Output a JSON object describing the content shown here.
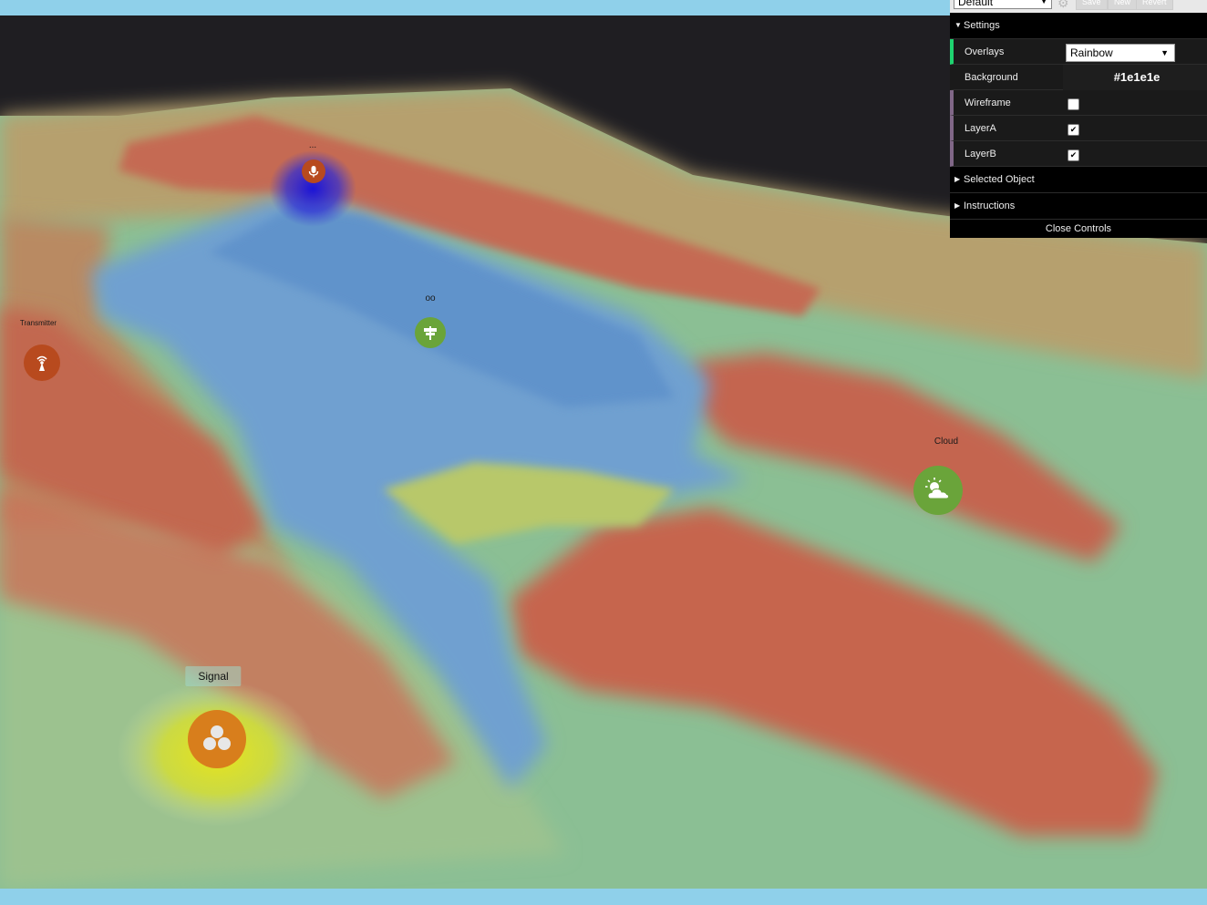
{
  "toolbar": {
    "preset_value": "Default",
    "save_label": "Save",
    "new_label": "New",
    "revert_label": "Revert"
  },
  "gui": {
    "settings_label": "Settings",
    "overlays_label": "Overlays",
    "overlays_value": "Rainbow",
    "background_label": "Background",
    "background_value": "#1e1e1e",
    "wireframe_label": "Wireframe",
    "wireframe_checked": false,
    "layer_a_label": "LayerA",
    "layer_a_checked": true,
    "layer_b_label": "LayerB",
    "layer_b_checked": true,
    "selected_object_label": "Selected Object",
    "instructions_label": "Instructions",
    "close_label": "Close Controls"
  },
  "markers": {
    "signal_label": "Signal",
    "cloud_label": "Cloud",
    "transmitter_label": "Transmitter",
    "top_label": "...",
    "mid_label": "oo"
  },
  "colors": {
    "background": "#1e1e1e",
    "accent_green": "#1ed36f",
    "accent_purple": "#806787",
    "marker_orange": "#d87e1c",
    "marker_green": "#6aa43a",
    "marker_red": "#b84a1e"
  },
  "icons": {
    "preset_arrow": "chevron-down-icon",
    "gear": "gear-icon",
    "signal": "signal-circles-icon",
    "cloud": "cloud-sun-icon",
    "transmitter": "antenna-icon",
    "microphone": "microphone-icon",
    "signpost": "signpost-icon"
  }
}
